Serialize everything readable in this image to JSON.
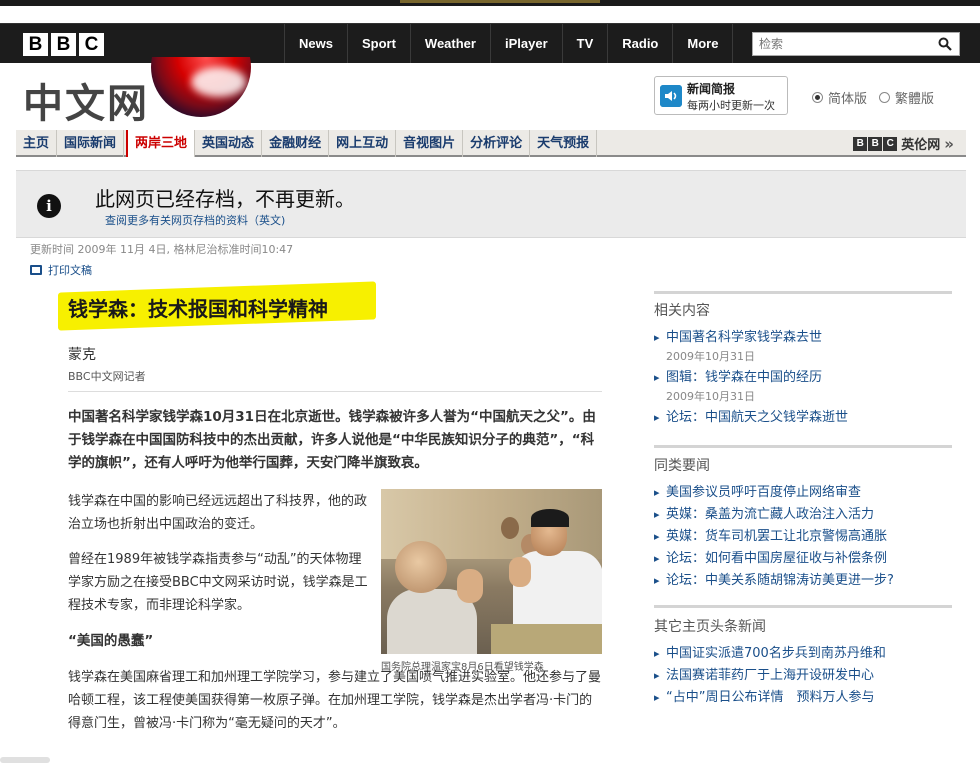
{
  "global_nav": {
    "logo": [
      "B",
      "B",
      "C"
    ],
    "items": [
      "News",
      "Sport",
      "Weather",
      "iPlayer",
      "TV",
      "Radio",
      "More"
    ],
    "search_placeholder": "检索"
  },
  "masthead": {
    "site_title": "中文网",
    "briefing_title": "新闻简报",
    "briefing_sub": "每两小时更新一次",
    "version_simplified": "简体版",
    "version_traditional": "繁體版"
  },
  "section_nav": {
    "items": [
      "主页",
      "国际新闻",
      "两岸三地",
      "英国动态",
      "金融财经",
      "网上互动",
      "音视图片",
      "分析评论",
      "天气预报"
    ],
    "current_index": 2,
    "english_link": "英伦网",
    "english_logo": [
      "B",
      "B",
      "C"
    ]
  },
  "archive_notice": {
    "heading": "此网页已经存档，不再更新。",
    "sub_link": "查阅更多有关网页存档的资料（英文)"
  },
  "meta": {
    "updated": "更新时间 2009年 11月 4日, 格林尼治标准时间10:47",
    "print": "打印文稿"
  },
  "article": {
    "headline": "钱学森：技术报国和科学精神",
    "author": "蒙克",
    "author_role": "BBC中文网记者",
    "lead": "中国著名科学家钱学森10月31日在北京逝世。钱学森被许多人誉为“中国航天之父”。由于钱学森在中国国防科技中的杰出贡献，许多人说他是“中华民族知识分子的典范”，“科学的旗帜”，还有人呼吁为他举行国葬，天安门降半旗致哀。",
    "para1": "钱学森在中国的影响已经远远超出了科技界，他的政治立场也折射出中国政治的变迁。",
    "para2": "曾经在1989年被钱学森指责参与“动乱”的天体物理学家方励之在接受BBC中文网采访时说，钱学森是工程技术专家，而非理论科学家。",
    "subhead": "“美国的愚蠢”",
    "para3": "钱学森在美国麻省理工和加州理工学院学习，参与建立了美国喷气推进实验室。他还参与了曼哈顿工程，该工程使美国获得第一枚原子弹。在加州理工学院，钱学森是杰出学者冯·卡门的得意门生，曾被冯·卡门称为“毫无疑问的天才”。",
    "photo_caption": "国务院总理温家宝8月6日看望钱学森"
  },
  "sidebar": {
    "related": {
      "title": "相关内容",
      "items": [
        {
          "text": "中国著名科学家钱学森去世",
          "date": "2009年10月31日"
        },
        {
          "text": "图辑：钱学森在中国的经历",
          "date": "2009年10月31日"
        },
        {
          "text": "论坛：中国航天之父钱学森逝世",
          "date": ""
        }
      ]
    },
    "similar": {
      "title": "同类要闻",
      "items": [
        "美国参议员呼吁百度停止网络审查",
        "英媒：桑盖为流亡藏人政治注入活力",
        "英媒：货车司机罢工让北京警惕高通胀",
        "论坛：如何看中国房屋征收与补偿条例",
        "论坛：中美关系随胡锦涛访美更进一步?"
      ]
    },
    "other": {
      "title": "其它主页头条新闻",
      "items": [
        "中国证实派遣700名步兵到南苏丹维和",
        "法国赛诺菲药厂于上海开设研发中心",
        "“占中”周日公布详情　预料万人参与"
      ]
    }
  },
  "colors": {
    "accent_red": "#cc0000",
    "link_blue": "#1a4f8a",
    "headline_highlight": "#f7f000"
  }
}
